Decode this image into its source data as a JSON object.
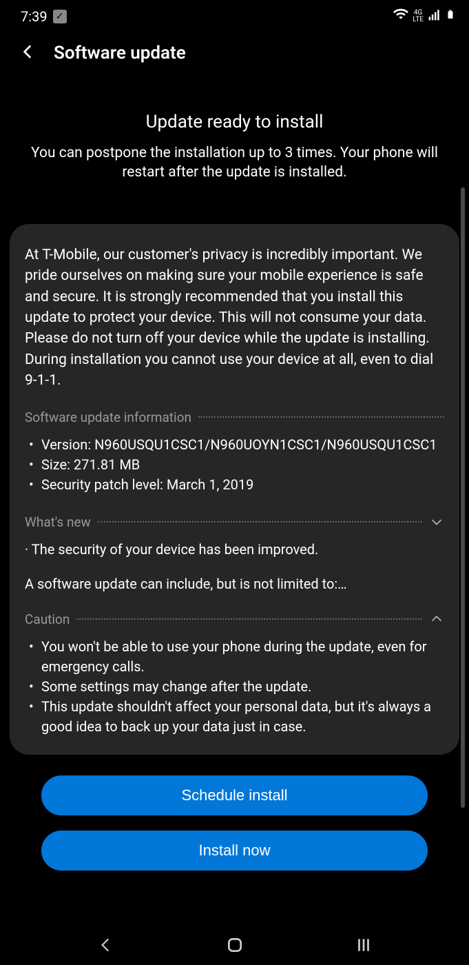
{
  "status": {
    "time": "7:39"
  },
  "appbar": {
    "title": "Software update"
  },
  "main": {
    "headline": "Update ready to install",
    "subhead": "You can postpone the installation up to 3 times. Your phone will restart after the update is installed."
  },
  "card": {
    "intro": "At T-Mobile, our customer's privacy is incredibly important. We pride ourselves on making sure your mobile experience is safe and secure. It is strongly recommended that you install this update to protect your device. This will not consume your data. Please do not turn off your device while the update is installing. During installation you cannot use your device at all, even to dial 9-1-1.",
    "info_section": {
      "label": "Software update information",
      "items": [
        "Version: N960USQU1CSC1/N960UOYN1CSC1/N960USQU1CSC1",
        "Size: 271.81 MB",
        "Security patch level: March 1, 2019"
      ]
    },
    "whatsnew": {
      "label": "What's new",
      "line1": "· The security of your device has been improved.",
      "line2": "A software update can include, but is not limited to:…"
    },
    "caution": {
      "label": "Caution",
      "items": [
        "You won't be able to use your phone during the update, even for emergency calls.",
        "Some settings may change after the update.",
        "This update shouldn't affect your personal data, but it's always a good idea to back up your data just in case."
      ]
    }
  },
  "buttons": {
    "schedule": "Schedule install",
    "install": "Install now"
  }
}
